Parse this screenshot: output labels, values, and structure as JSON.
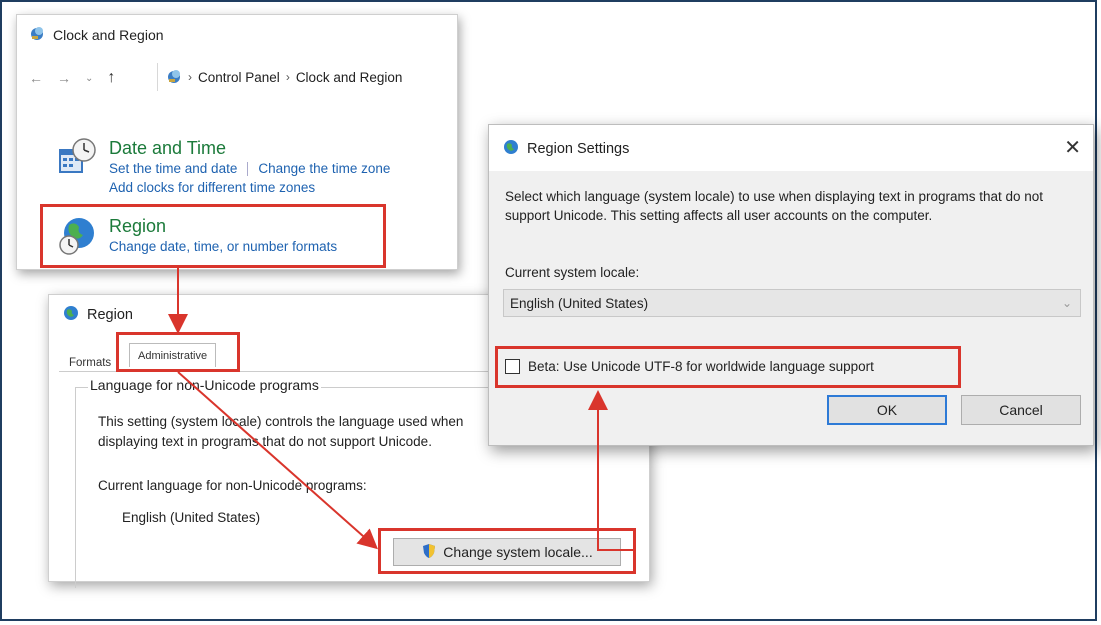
{
  "colors": {
    "highlight": "#d9352c",
    "link": "#1e62b0",
    "category_title": "#1b7a3a",
    "frame": "#1f3d60"
  },
  "control_panel": {
    "title": "Clock and Region",
    "breadcrumb": [
      "Control Panel",
      "Clock and Region"
    ],
    "date_time": {
      "title": "Date and Time",
      "links": [
        "Set the time and date",
        "Change the time zone",
        "Add clocks for different time zones"
      ]
    },
    "region": {
      "title": "Region",
      "link": "Change date, time, or number formats"
    }
  },
  "region_dialog": {
    "title": "Region",
    "tabs": [
      "Formats",
      "Administrative"
    ],
    "group_title": "Language for non-Unicode programs",
    "description": "This setting (system locale) controls the language used when displaying text in programs that do not support Unicode.",
    "current_label": "Current language for non-Unicode programs:",
    "current_value": "English (United States)",
    "change_button": "Change system locale..."
  },
  "region_settings": {
    "title": "Region Settings",
    "description": "Select which language (system locale) to use when displaying text in programs that do not support Unicode. This setting affects all user accounts on the computer.",
    "current_label": "Current system locale:",
    "current_value": "English (United States)",
    "beta_label": "Beta: Use Unicode UTF-8 for worldwide language support",
    "beta_checked": false,
    "ok": "OK",
    "cancel": "Cancel"
  },
  "icons": [
    "control-panel-icon",
    "clock-calendar-icon",
    "globe-clock-icon",
    "globe-icon",
    "shield-icon",
    "close-icon",
    "chevron-down-icon",
    "back-arrow-icon",
    "forward-arrow-icon",
    "up-arrow-icon"
  ]
}
